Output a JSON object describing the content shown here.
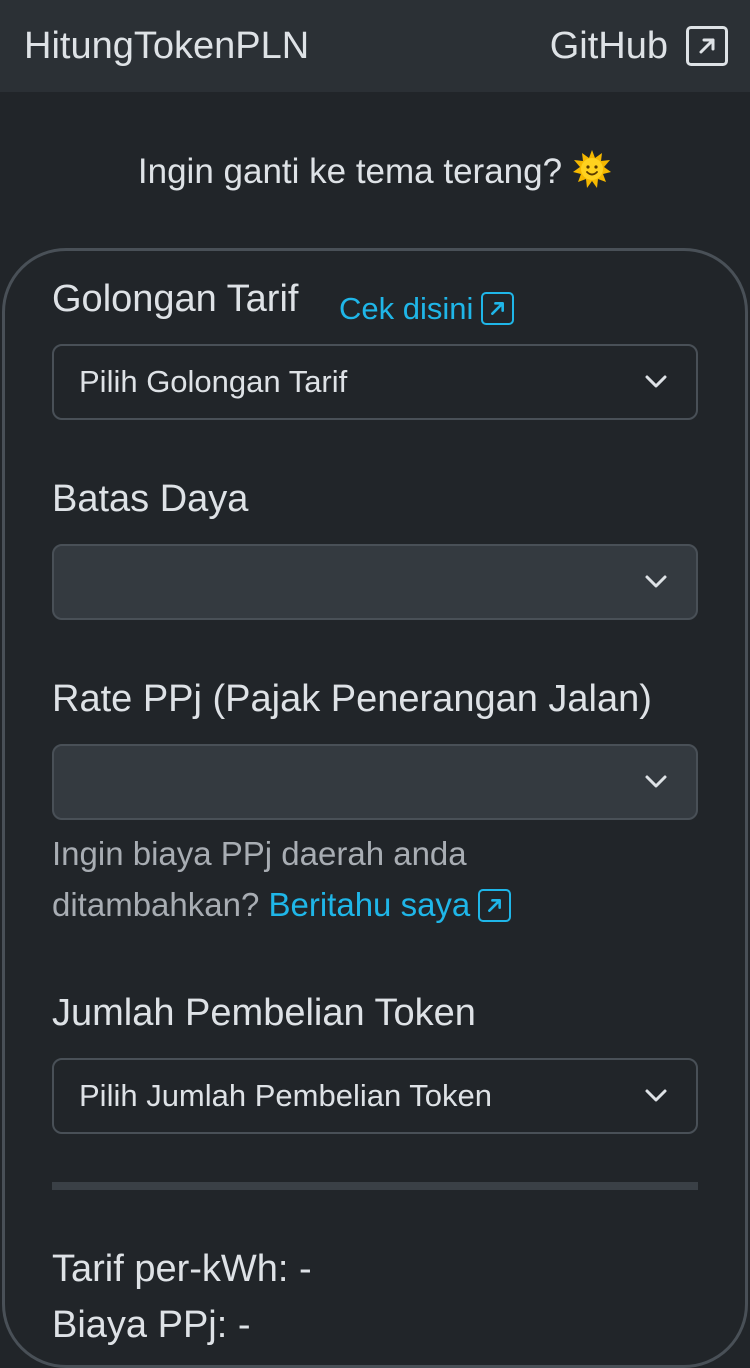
{
  "navbar": {
    "brand": "HitungTokenPLN",
    "github_label": "GitHub"
  },
  "theme_prompt": {
    "text": "Ingin ganti ke tema terang?",
    "icon": "sun-icon"
  },
  "form": {
    "golongan": {
      "label": "Golongan Tarif",
      "link_text": "Cek disini",
      "selected": "Pilih Golongan Tarif"
    },
    "batas_daya": {
      "label": "Batas Daya",
      "selected": ""
    },
    "ppj": {
      "label": "Rate PPj (Pajak Penerangan Jalan)",
      "selected": "",
      "help_text": "Ingin biaya PPj daerah anda ditambahkan?",
      "help_link": "Beritahu saya"
    },
    "jumlah": {
      "label": "Jumlah Pembelian Token",
      "selected": "Pilih Jumlah Pembelian Token"
    }
  },
  "results": {
    "tarif": "Tarif per-kWh: -",
    "biaya_ppj": "Biaya PPj: -"
  },
  "colors": {
    "background": "#212529",
    "navbar": "#2b3035",
    "link": "#1fb6e8",
    "text": "#dee2e6",
    "muted": "#a8adb3"
  }
}
